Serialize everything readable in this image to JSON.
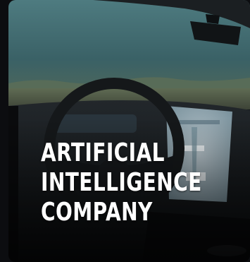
{
  "card": {
    "title_lines": [
      "ARTIFICIAL",
      "INTELLIGENCE",
      "COMPANY"
    ]
  },
  "colors": {
    "background": "#0c0d10",
    "title": "#ffffff",
    "sky": "#3f6a70",
    "dashboard": "#15181b"
  }
}
